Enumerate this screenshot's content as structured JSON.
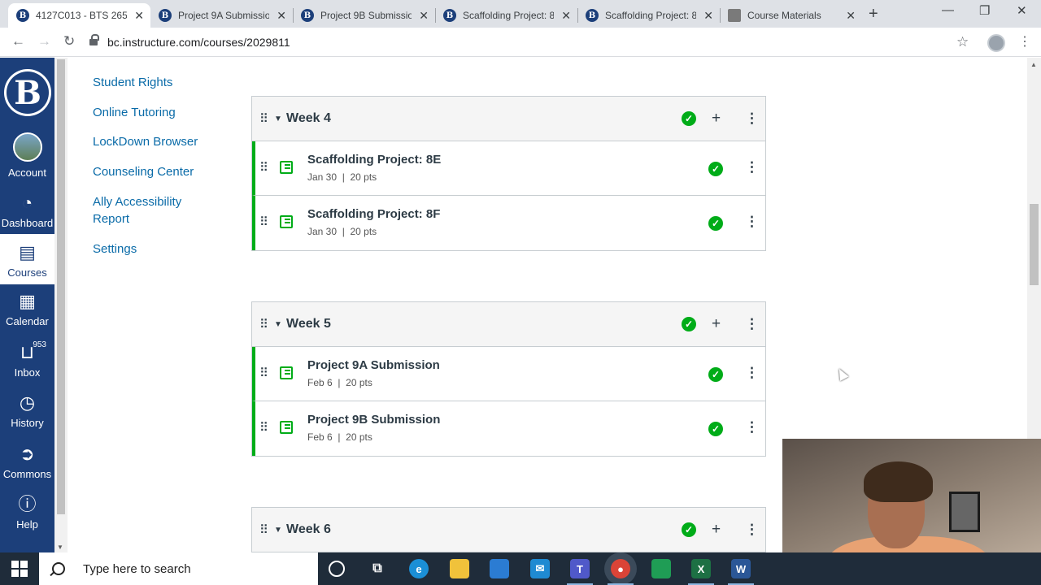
{
  "browser": {
    "tabs": [
      {
        "label": "4127C013 - BTS 265",
        "icon": "canvas-favicon",
        "active": true
      },
      {
        "label": "Project 9A Submissio",
        "icon": "canvas-favicon",
        "active": false
      },
      {
        "label": "Project 9B Submissio",
        "icon": "canvas-favicon",
        "active": false
      },
      {
        "label": "Scaffolding Project: 8",
        "icon": "canvas-favicon",
        "active": false
      },
      {
        "label": "Scaffolding Project: 8",
        "icon": "canvas-favicon",
        "active": false
      },
      {
        "label": "Course Materials",
        "icon": "document-favicon",
        "active": false
      }
    ],
    "url": "bc.instructure.com/courses/2029811"
  },
  "global_nav": {
    "logo_letter": "B",
    "items": [
      {
        "label": "Account",
        "icon": "avatar"
      },
      {
        "label": "Dashboard",
        "icon": "dashboard-icon"
      },
      {
        "label": "Courses",
        "icon": "courses-icon",
        "active": true
      },
      {
        "label": "Calendar",
        "icon": "calendar-icon"
      },
      {
        "label": "Inbox",
        "icon": "inbox-icon",
        "badge": "953"
      },
      {
        "label": "History",
        "icon": "history-icon"
      },
      {
        "label": "Commons",
        "icon": "commons-icon"
      },
      {
        "label": "Help",
        "icon": "help-icon"
      }
    ]
  },
  "course_nav": {
    "links": [
      {
        "label": "Student Rights"
      },
      {
        "label": "Online Tutoring"
      },
      {
        "label": "LockDown Browser"
      },
      {
        "label": "Counseling Center"
      },
      {
        "label": "Ally Accessibility Report"
      },
      {
        "label": "Settings"
      }
    ]
  },
  "modules": [
    {
      "title": "Week 4",
      "items": [
        {
          "title": "Scaffolding Project: 8E",
          "date": "Jan 30",
          "points": "20 pts"
        },
        {
          "title": "Scaffolding Project: 8F",
          "date": "Jan 30",
          "points": "20 pts"
        }
      ]
    },
    {
      "title": "Week 5",
      "items": [
        {
          "title": "Project 9A Submission",
          "date": "Feb 6",
          "points": "20 pts"
        },
        {
          "title": "Project 9B Submission",
          "date": "Feb 6",
          "points": "20 pts"
        }
      ]
    },
    {
      "title": "Week 6",
      "items": []
    }
  ],
  "taskbar": {
    "search_placeholder": "Type here to search"
  },
  "colors": {
    "canvas_nav": "#1c3f7a",
    "link": "#0a6ba8",
    "published_green": "#00ac18"
  }
}
